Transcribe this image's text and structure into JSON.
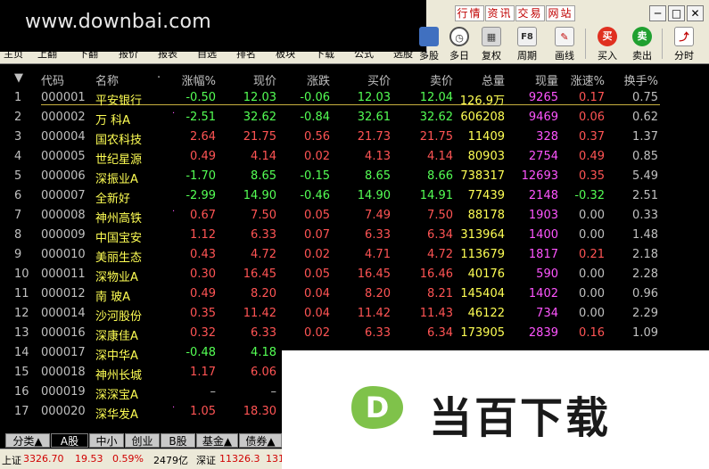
{
  "watermark_text": "www.downbai.com",
  "toolbar": {
    "strip": [
      "主页",
      "上翻",
      "下翻",
      "报价",
      "报表",
      "自选",
      "排名",
      "板块",
      "下载",
      "公式",
      "选股"
    ],
    "tools": [
      {
        "label": "多股",
        "icon": "multi-stock-icon"
      },
      {
        "label": "多日",
        "icon": "clock-icon"
      },
      {
        "label": "复权",
        "icon": "adjust-icon"
      },
      {
        "label": "周期",
        "icon": "period-icon",
        "glyph": "F8"
      },
      {
        "label": "画线",
        "icon": "draw-line-icon"
      },
      {
        "label": "买入",
        "icon": "buy-icon",
        "glyph": "买"
      },
      {
        "label": "卖出",
        "icon": "sell-icon",
        "glyph": "卖"
      },
      {
        "label": "分时",
        "icon": "timeshare-chart-icon"
      }
    ],
    "menu_links": [
      "行情",
      "资讯",
      "交易",
      "网站"
    ],
    "window_controls": {
      "minimize": "─",
      "maximize": "□",
      "close": "✕"
    }
  },
  "table": {
    "sort_arrow": "▼",
    "headers": {
      "code": "代码",
      "name": "名称",
      "name_dot": "·",
      "pct": "涨幅%",
      "price": "现价",
      "change": "涨跌",
      "bid": "买价",
      "ask": "卖价",
      "volume": "总量",
      "last_vol": "现量",
      "speed": "涨速%",
      "turnover": "换手%"
    },
    "rows": [
      {
        "idx": "1",
        "code": "000001",
        "name": "平安银行",
        "dot": "",
        "pct": "-0.50",
        "price": "12.03",
        "change": "-0.06",
        "bid": "12.03",
        "ask": "12.04",
        "volume": "126.9万",
        "last_vol": "9265",
        "speed": "0.17",
        "turnover": "0.75",
        "dir": "green",
        "spd_dir": "red"
      },
      {
        "idx": "2",
        "code": "000002",
        "name": "万 科A",
        "dot": "·",
        "pct": "-2.51",
        "price": "32.62",
        "change": "-0.84",
        "bid": "32.61",
        "ask": "32.62",
        "volume": "606208",
        "last_vol": "9469",
        "speed": "0.06",
        "turnover": "0.62",
        "dir": "green",
        "spd_dir": "red"
      },
      {
        "idx": "3",
        "code": "000004",
        "name": "国农科技",
        "dot": "",
        "pct": "2.64",
        "price": "21.75",
        "change": "0.56",
        "bid": "21.73",
        "ask": "21.75",
        "volume": "11409",
        "last_vol": "328",
        "speed": "0.37",
        "turnover": "1.37",
        "dir": "red",
        "spd_dir": "red"
      },
      {
        "idx": "4",
        "code": "000005",
        "name": "世纪星源",
        "dot": "",
        "pct": "0.49",
        "price": "4.14",
        "change": "0.02",
        "bid": "4.13",
        "ask": "4.14",
        "volume": "80903",
        "last_vol": "2754",
        "speed": "0.49",
        "turnover": "0.85",
        "dir": "red",
        "spd_dir": "red"
      },
      {
        "idx": "5",
        "code": "000006",
        "name": "深振业A",
        "dot": "",
        "pct": "-1.70",
        "price": "8.65",
        "change": "-0.15",
        "bid": "8.65",
        "ask": "8.66",
        "volume": "738317",
        "last_vol": "12693",
        "speed": "0.35",
        "turnover": "5.49",
        "dir": "green",
        "spd_dir": "red"
      },
      {
        "idx": "6",
        "code": "000007",
        "name": "全新好",
        "dot": "",
        "pct": "-2.99",
        "price": "14.90",
        "change": "-0.46",
        "bid": "14.90",
        "ask": "14.91",
        "volume": "77439",
        "last_vol": "2148",
        "speed": "-0.32",
        "turnover": "2.51",
        "dir": "green",
        "spd_dir": "green"
      },
      {
        "idx": "7",
        "code": "000008",
        "name": "神州高铁",
        "dot": "·",
        "pct": "0.67",
        "price": "7.50",
        "change": "0.05",
        "bid": "7.49",
        "ask": "7.50",
        "volume": "88178",
        "last_vol": "1903",
        "speed": "0.00",
        "turnover": "0.33",
        "dir": "red",
        "spd_dir": "white"
      },
      {
        "idx": "8",
        "code": "000009",
        "name": "中国宝安",
        "dot": "",
        "pct": "1.12",
        "price": "6.33",
        "change": "0.07",
        "bid": "6.33",
        "ask": "6.34",
        "volume": "313964",
        "last_vol": "1400",
        "speed": "0.00",
        "turnover": "1.48",
        "dir": "red",
        "spd_dir": "white"
      },
      {
        "idx": "9",
        "code": "000010",
        "name": "美丽生态",
        "dot": "",
        "pct": "0.43",
        "price": "4.72",
        "change": "0.02",
        "bid": "4.71",
        "ask": "4.72",
        "volume": "113679",
        "last_vol": "1817",
        "speed": "0.21",
        "turnover": "2.18",
        "dir": "red",
        "spd_dir": "red"
      },
      {
        "idx": "10",
        "code": "000011",
        "name": "深物业A",
        "dot": "",
        "pct": "0.30",
        "price": "16.45",
        "change": "0.05",
        "bid": "16.45",
        "ask": "16.46",
        "volume": "40176",
        "last_vol": "590",
        "speed": "0.00",
        "turnover": "2.28",
        "dir": "red",
        "spd_dir": "white"
      },
      {
        "idx": "11",
        "code": "000012",
        "name": "南 玻A",
        "dot": "",
        "pct": "0.49",
        "price": "8.20",
        "change": "0.04",
        "bid": "8.20",
        "ask": "8.21",
        "volume": "145404",
        "last_vol": "1402",
        "speed": "0.00",
        "turnover": "0.96",
        "dir": "red",
        "spd_dir": "white"
      },
      {
        "idx": "12",
        "code": "000014",
        "name": "沙河股份",
        "dot": "",
        "pct": "0.35",
        "price": "11.42",
        "change": "0.04",
        "bid": "11.42",
        "ask": "11.43",
        "volume": "46122",
        "last_vol": "734",
        "speed": "0.00",
        "turnover": "2.29",
        "dir": "red",
        "spd_dir": "white"
      },
      {
        "idx": "13",
        "code": "000016",
        "name": "深康佳A",
        "dot": "",
        "pct": "0.32",
        "price": "6.33",
        "change": "0.02",
        "bid": "6.33",
        "ask": "6.34",
        "volume": "173905",
        "last_vol": "2839",
        "speed": "0.16",
        "turnover": "1.09",
        "dir": "red",
        "spd_dir": "red"
      },
      {
        "idx": "14",
        "code": "000017",
        "name": "深中华A",
        "dot": "",
        "pct": "-0.48",
        "price": "4.18",
        "change": "",
        "bid": "",
        "ask": "",
        "volume": "",
        "last_vol": "",
        "speed": "",
        "turnover": "",
        "dir": "green",
        "spd_dir": "white"
      },
      {
        "idx": "15",
        "code": "000018",
        "name": "神州长城",
        "dot": "",
        "pct": "1.17",
        "price": "6.06",
        "change": "",
        "bid": "",
        "ask": "",
        "volume": "",
        "last_vol": "",
        "speed": "",
        "turnover": "",
        "dir": "red",
        "spd_dir": "white"
      },
      {
        "idx": "16",
        "code": "000019",
        "name": "深深宝A",
        "dot": "",
        "pct": "–",
        "price": "–",
        "change": "",
        "bid": "",
        "ask": "",
        "volume": "",
        "last_vol": "",
        "speed": "",
        "turnover": "",
        "dir": "white",
        "spd_dir": "white"
      },
      {
        "idx": "17",
        "code": "000020",
        "name": "深华发A",
        "dot": "·",
        "pct": "1.05",
        "price": "18.30",
        "change": "",
        "bid": "",
        "ask": "",
        "volume": "",
        "last_vol": "",
        "speed": "",
        "turnover": "",
        "dir": "red",
        "spd_dir": "white"
      }
    ]
  },
  "tabs": [
    {
      "label": "分类▲",
      "active": false
    },
    {
      "label": "A股",
      "active": true
    },
    {
      "label": "中小",
      "active": false
    },
    {
      "label": "创业",
      "active": false
    },
    {
      "label": "B股",
      "active": false
    },
    {
      "label": "基金▲",
      "active": false
    },
    {
      "label": "债券▲",
      "active": false
    }
  ],
  "statusbar": {
    "sh_label": "上证",
    "sh_index": "3326.70",
    "sh_change": "19.53",
    "sh_pct": "0.59%",
    "sh_amount": "2479亿",
    "sz_label": "深证",
    "sz_index": "11326.3",
    "sz_tail": "131"
  },
  "overlay": {
    "logo_letter": "D",
    "logo_text": "当百下载"
  },
  "colors": {
    "up": "#ff5454",
    "down": "#54ff54",
    "flat": "#c0c0c0",
    "name": "#ffff54",
    "last_vol": "#ff55ff",
    "logo_green": "#7fc24a"
  }
}
